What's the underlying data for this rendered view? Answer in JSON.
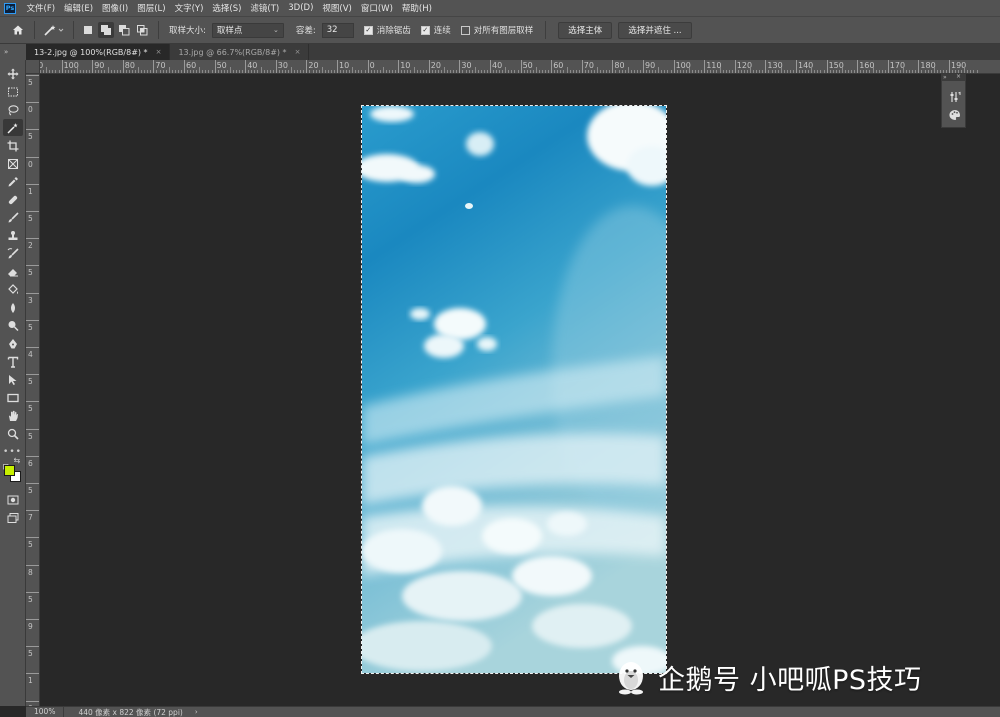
{
  "app": {
    "logo_text": "Ps",
    "menu": [
      "文件(F)",
      "编辑(E)",
      "图像(I)",
      "图层(L)",
      "文字(Y)",
      "选择(S)",
      "滤镜(T)",
      "3D(D)",
      "视图(V)",
      "窗口(W)",
      "帮助(H)"
    ]
  },
  "options_bar": {
    "sample_size_label": "取样大小:",
    "sample_size_value": "取样点",
    "tolerance_label": "容差:",
    "tolerance_value": "32",
    "anti_alias": {
      "label": "消除锯齿",
      "checked": true
    },
    "contiguous": {
      "label": "连续",
      "checked": true
    },
    "sample_all_layers": {
      "label": "对所有图层取样",
      "checked": false
    },
    "select_subject_button": "选择主体",
    "select_and_mask_button": "选择并遮住 ..."
  },
  "tabs": [
    {
      "label": "13-2.jpg @ 100%(RGB/8#) *",
      "active": true,
      "close": "×"
    },
    {
      "label": "13.jpg @ 66.7%(RGB/8#) *",
      "active": false,
      "close": "×"
    }
  ],
  "ruler": {
    "h_labels": [
      "10",
      "100",
      "90",
      "80",
      "70",
      "60",
      "50",
      "40",
      "30",
      "20",
      "10",
      "0",
      "10",
      "20",
      "30",
      "40",
      "50",
      "60",
      "70",
      "80",
      "90",
      "100",
      "110",
      "120",
      "130",
      "140",
      "150",
      "160",
      "170",
      "180",
      "190"
    ],
    "v_labels": [
      "5",
      "0",
      "5",
      "0",
      "1",
      "5",
      "2",
      "5",
      "3",
      "5",
      "4",
      "5",
      "5",
      "5",
      "6",
      "5",
      "7",
      "5",
      "8",
      "5",
      "9",
      "5",
      "1",
      "0"
    ]
  },
  "toolbar": {
    "tools": [
      "move-tool",
      "marquee-tool",
      "lasso-tool",
      "magic-wand-tool",
      "crop-tool",
      "frame-tool",
      "eyedropper-tool",
      "healing-brush-tool",
      "brush-tool",
      "clone-stamp-tool",
      "history-brush-tool",
      "eraser-tool",
      "paint-bucket-tool",
      "blur-tool",
      "dodge-tool",
      "pen-tool",
      "type-tool",
      "path-selection-tool",
      "rectangle-tool",
      "hand-tool",
      "zoom-tool"
    ],
    "active_tool": "magic-wand-tool",
    "more_tools": "•••",
    "foreground_color": "#c8f000",
    "background_color": "#ffffff"
  },
  "status": {
    "zoom": "100%",
    "doc_info": "440 像素 x 822 像素 (72 ppi)",
    "arrow": "›"
  },
  "watermark": {
    "text": "企鹅号 小吧呱PS技巧"
  },
  "colors": {
    "ui_panel": "#535353",
    "canvas_bg": "#282828",
    "sky_top": "#1e8ec2",
    "sky_mid": "#2f9fcc",
    "cloud": "#f4fbfb"
  }
}
